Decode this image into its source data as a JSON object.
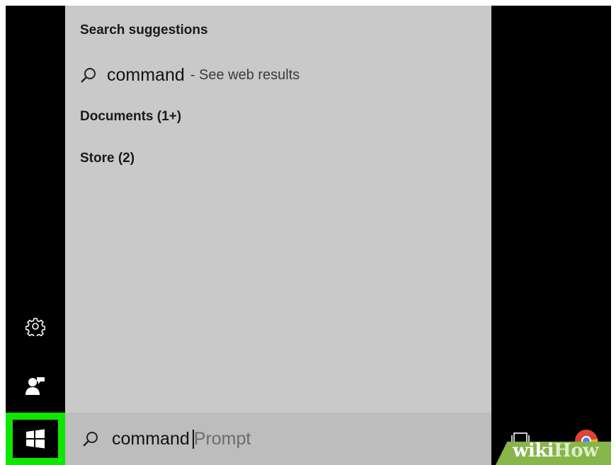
{
  "start_menu": {
    "sections": {
      "suggestions_header": "Search suggestions",
      "documents": "Documents (1+)",
      "store": "Store (2)"
    },
    "suggestion": {
      "query": "command",
      "hint": "- See web results"
    }
  },
  "search_box": {
    "typed_text": "command",
    "autocomplete_text": "Prompt"
  },
  "rail": {
    "settings_icon": "gear-icon",
    "user_icon": "user-icon",
    "start_icon": "windows-logo-icon",
    "highlight_color": "#0fe600"
  },
  "taskbar": {
    "task_view_icon": "task-view-icon",
    "browser_icon": "browser-icon"
  },
  "watermark": {
    "part1": "wiki",
    "part2": "How"
  },
  "colors": {
    "panel_bg": "#c9c9c9",
    "searchbar_bg": "#bdbdbd",
    "rail_bg": "#000000",
    "watermark_green": "#86b54a"
  }
}
